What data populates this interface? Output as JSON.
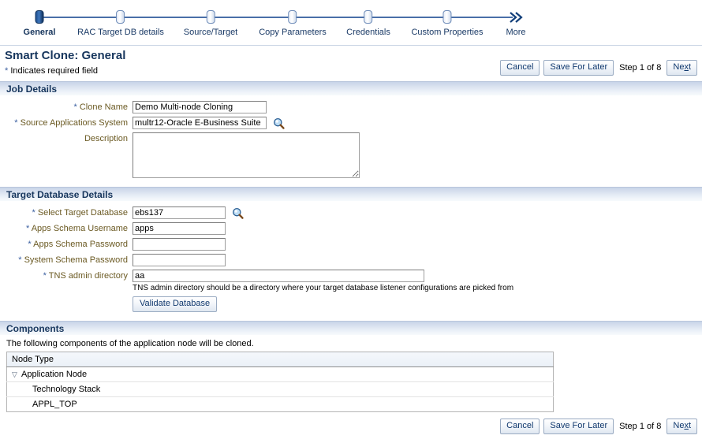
{
  "train": {
    "stops": [
      {
        "label": "General",
        "current": true
      },
      {
        "label": "RAC Target DB details",
        "current": false
      },
      {
        "label": "Source/Target",
        "current": false
      },
      {
        "label": "Copy Parameters",
        "current": false
      },
      {
        "label": "Credentials",
        "current": false
      },
      {
        "label": "Custom Properties",
        "current": false
      }
    ],
    "more_label": "More",
    "chevron_icon": "double-chevron-right-icon"
  },
  "page": {
    "title": "Smart Clone: General",
    "required_note": "Indicates required field",
    "required_marker": "*"
  },
  "toolbar": {
    "cancel_label": "Cancel",
    "save_for_later_label": "Save For Later",
    "step_text": "Step 1 of 8",
    "next_label_pre": "Ne",
    "next_label_acc": "x",
    "next_label_post": "t"
  },
  "job_details": {
    "section_title": "Job Details",
    "clone_name": {
      "label": "Clone Name",
      "value": "Demo Multi-node Cloning",
      "placeholder": ""
    },
    "source_applications_system": {
      "label": "Source Applications System",
      "value": "multr12-Oracle E-Business Suite",
      "placeholder": "",
      "lov_icon": "magnifier-icon"
    },
    "description": {
      "label": "Description",
      "value": "",
      "placeholder": ""
    }
  },
  "target_database_details": {
    "section_title": "Target Database Details",
    "select_target_database": {
      "label": "Select Target Database",
      "value": "ebs137",
      "placeholder": "",
      "lov_icon": "magnifier-icon"
    },
    "apps_schema_username": {
      "label": "Apps Schema Username",
      "value": "apps",
      "placeholder": ""
    },
    "apps_schema_password": {
      "label": "Apps Schema Password",
      "value": "",
      "placeholder": ""
    },
    "system_schema_password": {
      "label": "System Schema Password",
      "value": "",
      "placeholder": ""
    },
    "tns_admin_directory": {
      "label": "TNS admin directory",
      "value": "aa",
      "placeholder": "",
      "hint": "TNS admin directory should be a directory where your target database listener configurations are picked from"
    },
    "validate_button_label": "Validate Database"
  },
  "components": {
    "section_title": "Components",
    "description": "The following components of the application node will be cloned.",
    "column_header": "Node Type",
    "rows": [
      {
        "label": "Application Node",
        "level": 0,
        "expanded": true,
        "toggle_icon": "triangle-down-icon"
      },
      {
        "label": "Technology Stack",
        "level": 1,
        "expanded": false,
        "toggle_icon": ""
      },
      {
        "label": "APPL_TOP",
        "level": 1,
        "expanded": false,
        "toggle_icon": ""
      }
    ]
  },
  "footer": {
    "cancel_label": "Cancel",
    "save_for_later_label": "Save For Later",
    "step_text": "Step 1 of 8",
    "next_label_pre": "Ne",
    "next_label_acc": "x",
    "next_label_post": "t"
  },
  "colors": {
    "title": "#17365d",
    "label": "#6b5a23",
    "required_star": "#3a5fa0",
    "train_line": "#4a6fa8",
    "current_node": "#1f4f8f"
  }
}
